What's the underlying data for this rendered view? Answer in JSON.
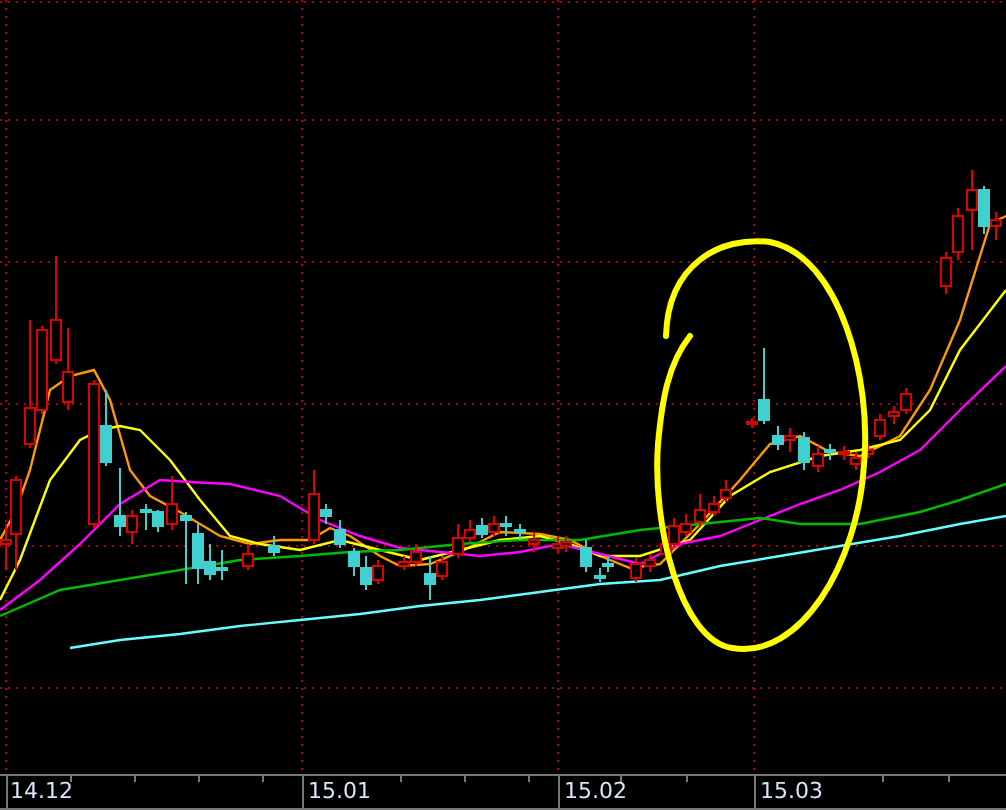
{
  "chart": {
    "x_axis_labels": [
      "14.12",
      "15.01",
      "15.02",
      "15.03"
    ]
  }
}
